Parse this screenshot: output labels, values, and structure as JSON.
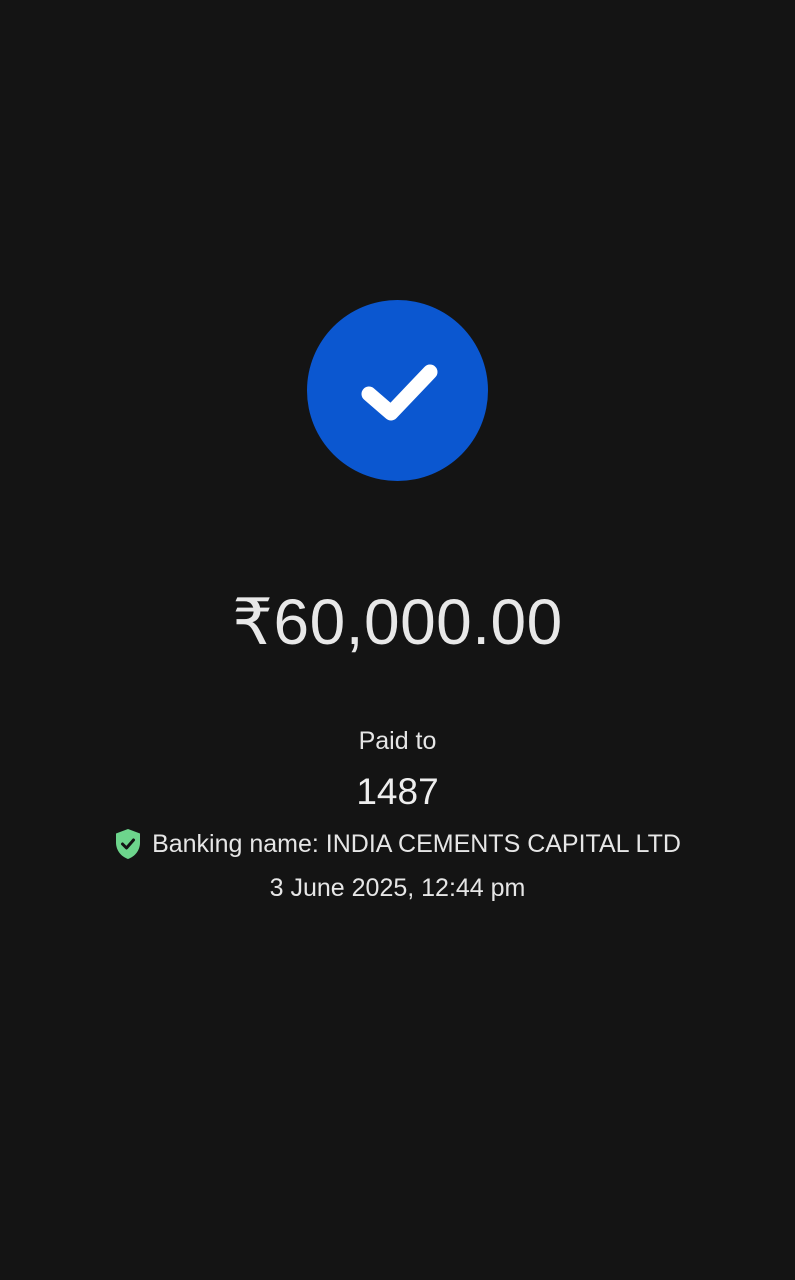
{
  "payment": {
    "status_icon": "check-circle-icon",
    "amount": "₹60,000.00",
    "paid_to_label": "Paid to",
    "payee": "1487",
    "verified_icon": "shield-check-icon",
    "banking_name": "Banking name: INDIA CEMENTS CAPITAL LTD",
    "timestamp": "3 June 2025, 12:44 pm"
  },
  "colors": {
    "background": "#141414",
    "success_circle": "#0b57d0",
    "verified_shield": "#6dd58c",
    "text": "#e6e6e6"
  }
}
